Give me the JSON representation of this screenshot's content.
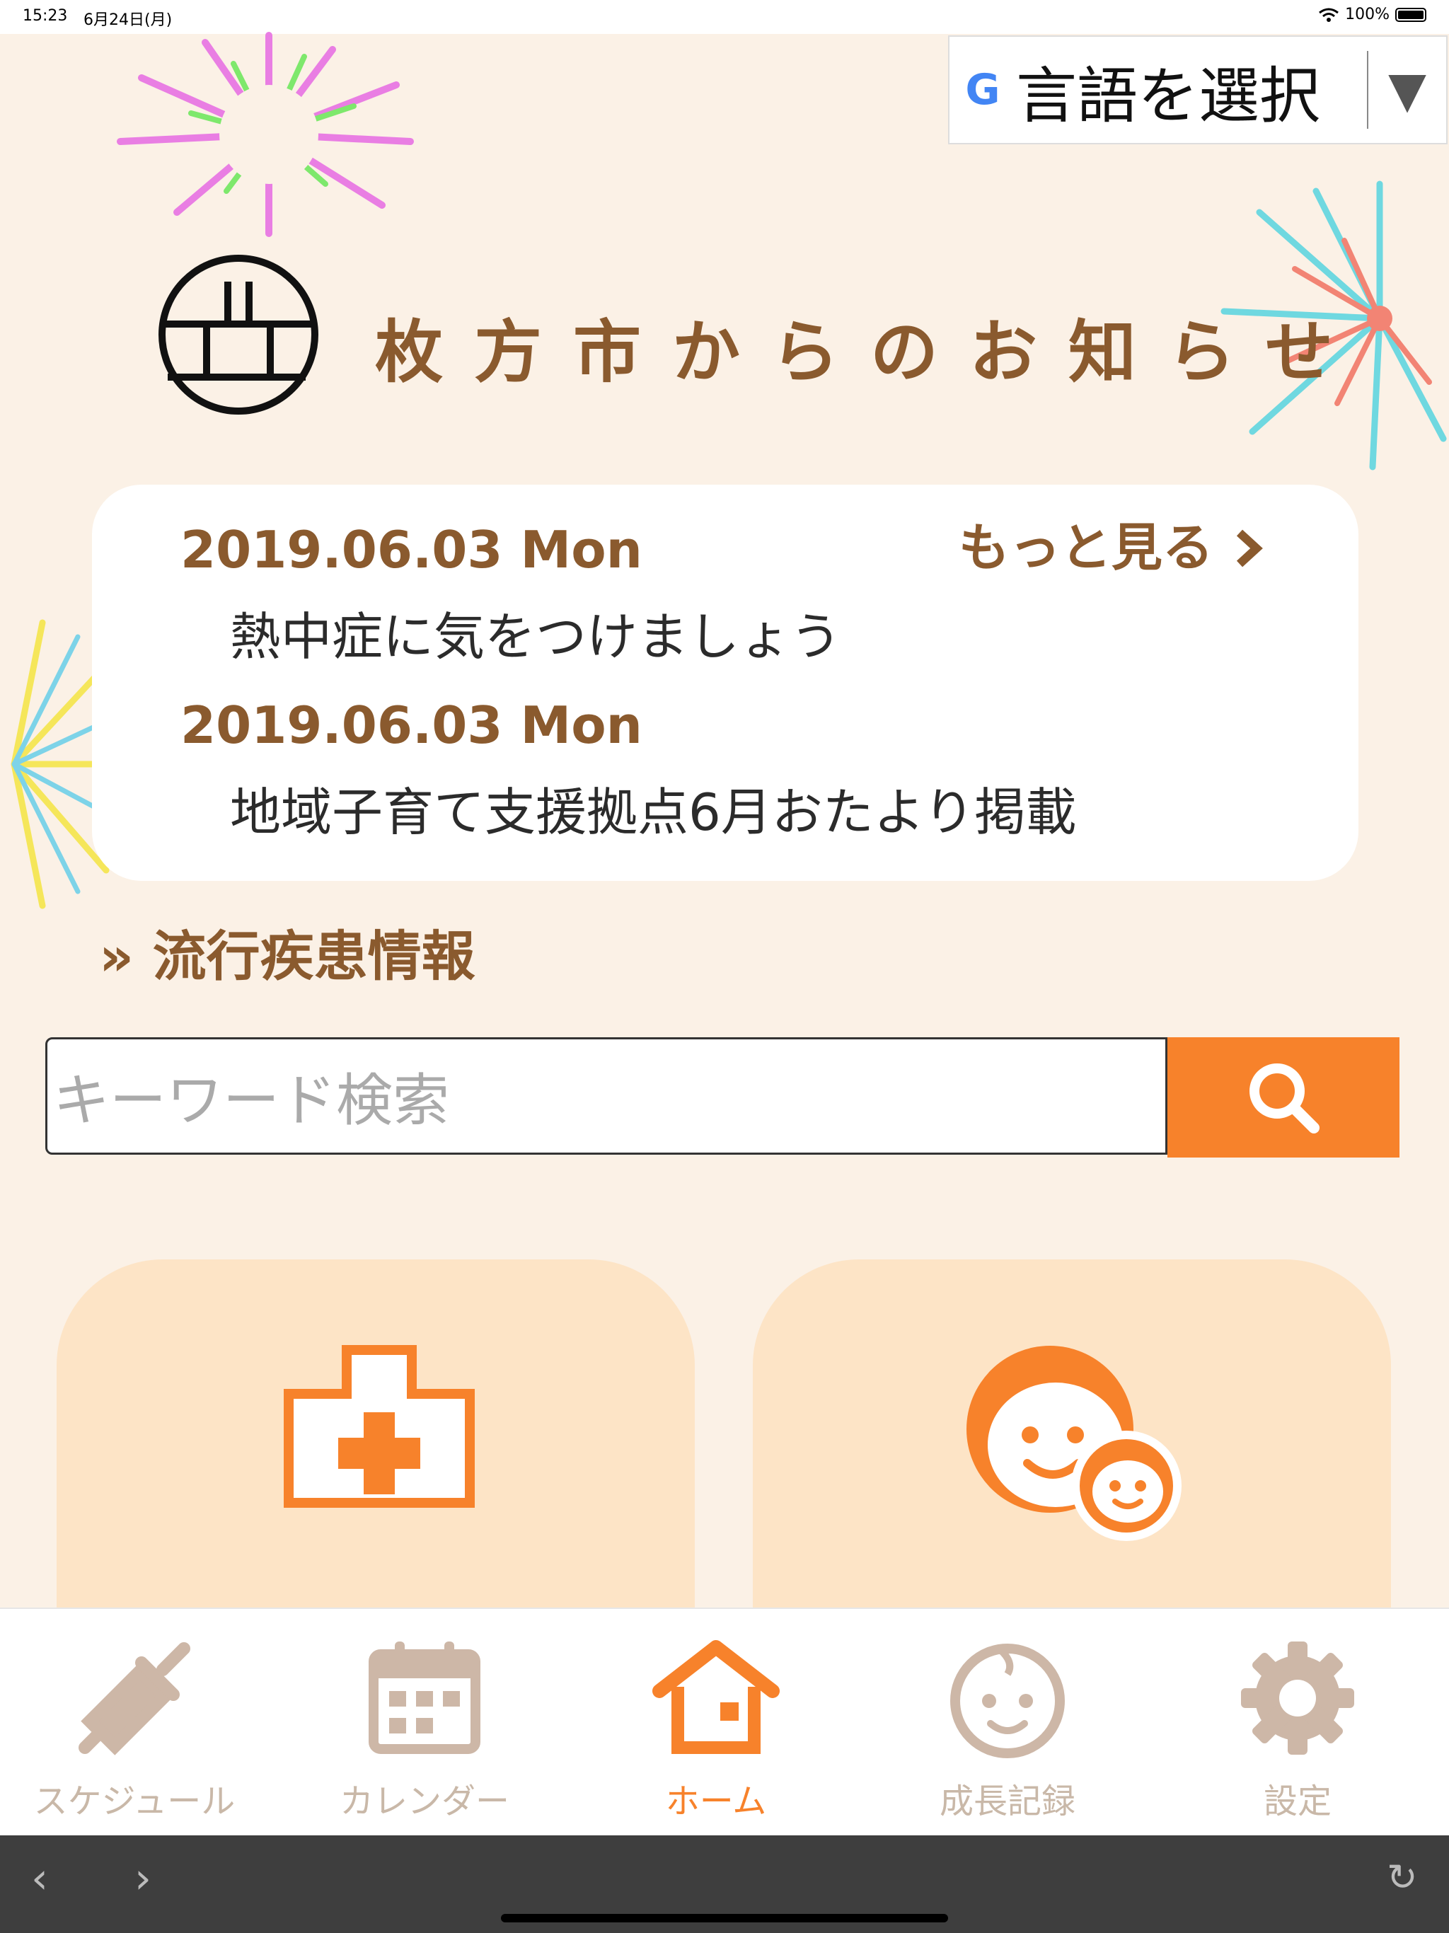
{
  "status": {
    "time": "15:23",
    "date": "6月24日(月)",
    "battery": "100%"
  },
  "translate": {
    "g": "G",
    "label": "言語を選択",
    "arrow": "▼"
  },
  "header": {
    "title": "枚方市からのお知らせ"
  },
  "news": {
    "more_label": "もっと見る",
    "more_icon": "chevron-right-icon",
    "items": [
      {
        "date": "2019.06.03 Mon",
        "text": "熱中症に気をつけましょう"
      },
      {
        "date": "2019.06.03 Mon",
        "text": "地域子育て支援拠点6月おたより掲載"
      }
    ]
  },
  "disease": {
    "prefix": "»",
    "label": "流行疾患情報"
  },
  "search": {
    "placeholder": "キーワード検索"
  },
  "tabs": [
    {
      "label": "スケジュール",
      "icon": "syringe-icon"
    },
    {
      "label": "カレンダー",
      "icon": "calendar-icon"
    },
    {
      "label": "ホーム",
      "icon": "home-icon",
      "active": true
    },
    {
      "label": "成長記録",
      "icon": "baby-face-icon"
    },
    {
      "label": "設定",
      "icon": "gear-icon"
    }
  ],
  "browser": {
    "back": "‹",
    "forward": "›",
    "reload": "↻"
  },
  "colors": {
    "accent": "#f7822b",
    "brown": "#8a5a2e",
    "card": "#fde4c6",
    "background": "#fbf1e6"
  }
}
